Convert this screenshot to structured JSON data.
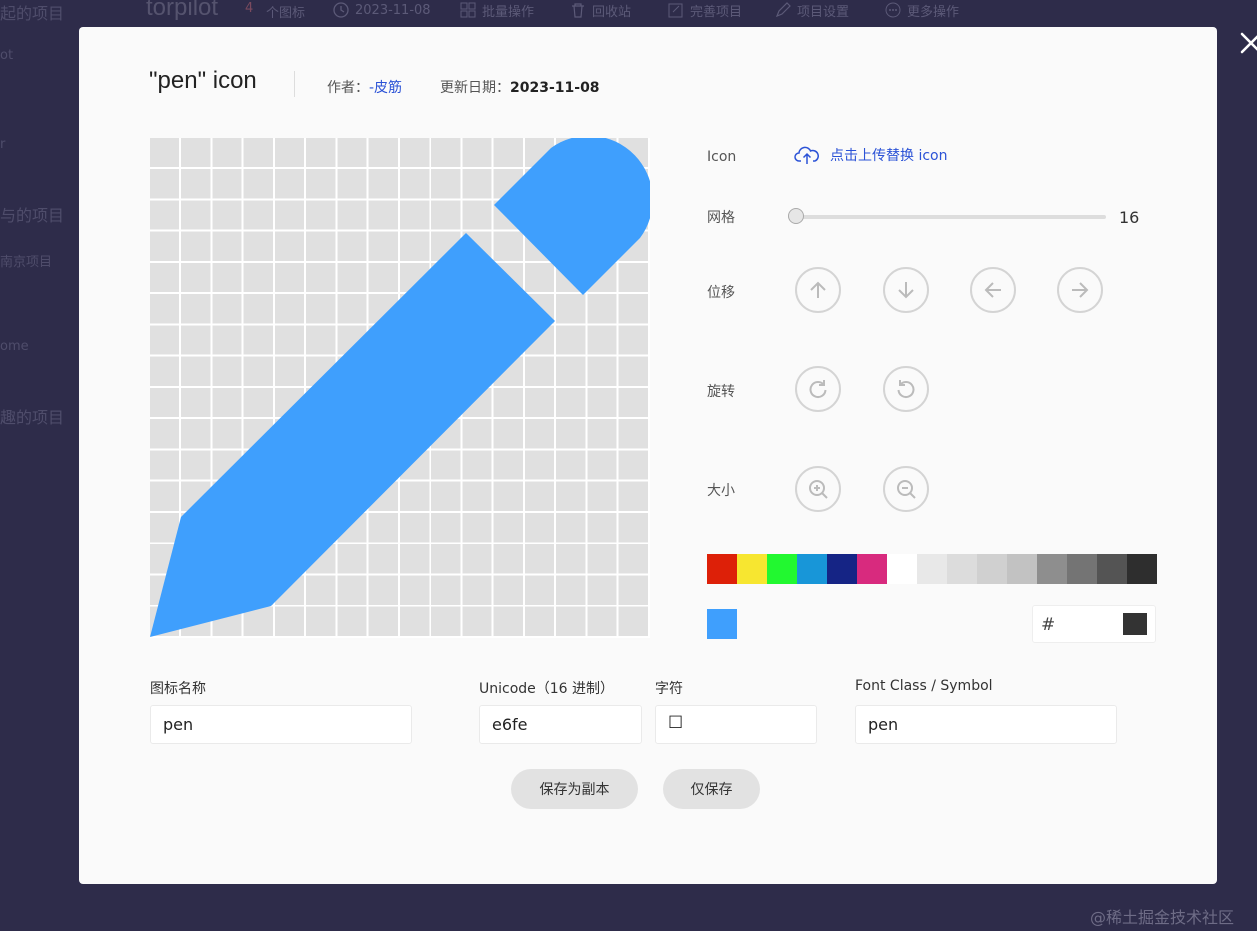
{
  "background": {
    "brand": "torpilot",
    "icon_count": "4",
    "icon_count_label": "个图标",
    "toolbar": [
      {
        "label": "2023-11-08",
        "icon": "clock-icon"
      },
      {
        "label": "批量操作",
        "icon": "grid-icon"
      },
      {
        "label": "回收站",
        "icon": "trash-icon"
      },
      {
        "label": "完善项目",
        "icon": "edit-box-icon"
      },
      {
        "label": "项目设置",
        "icon": "pen-icon"
      },
      {
        "label": "更多操作",
        "icon": "more-icon"
      }
    ],
    "sidebar": [
      "起的项目",
      "ot",
      "r",
      "与的项目",
      "南京项目",
      "ome",
      "趣的项目"
    ],
    "watermark": "@稀土掘金技术社区"
  },
  "modal": {
    "title": "\"pen\"  icon",
    "author_label": "作者：",
    "author": "-皮筋",
    "updated_label": "更新日期：",
    "updated": "2023-11-08",
    "icon_label": "Icon",
    "upload_label": "点击上传替换 icon",
    "grid_label": "网格",
    "grid_value": "16",
    "grid_level": 16,
    "move_label": "位移",
    "rotate_label": "旋转",
    "size_label": "大小",
    "palette": [
      "#dd2008",
      "#f7e630",
      "#22f830",
      "#1896d8",
      "#152485",
      "#d82a7e",
      "#ffffff",
      "#e8e8e8",
      "#dcdcdc",
      "#d0d0d0",
      "#c2c2c2",
      "#8e8e8e",
      "#747474",
      "#545454",
      "#2e2e2e"
    ],
    "current_color": "#3f9ffd",
    "hex_prefix": "#",
    "fields": {
      "name_label": "图标名称",
      "name_value": "pen",
      "unicode_label": "Unicode（16 进制）",
      "unicode_value": "e6fe",
      "char_label": "字符",
      "char_value": "☐",
      "fontclass_label": "Font Class / Symbol",
      "fontclass_value": "pen"
    },
    "save_copy": "保存为副本",
    "save_only": "仅保存"
  }
}
